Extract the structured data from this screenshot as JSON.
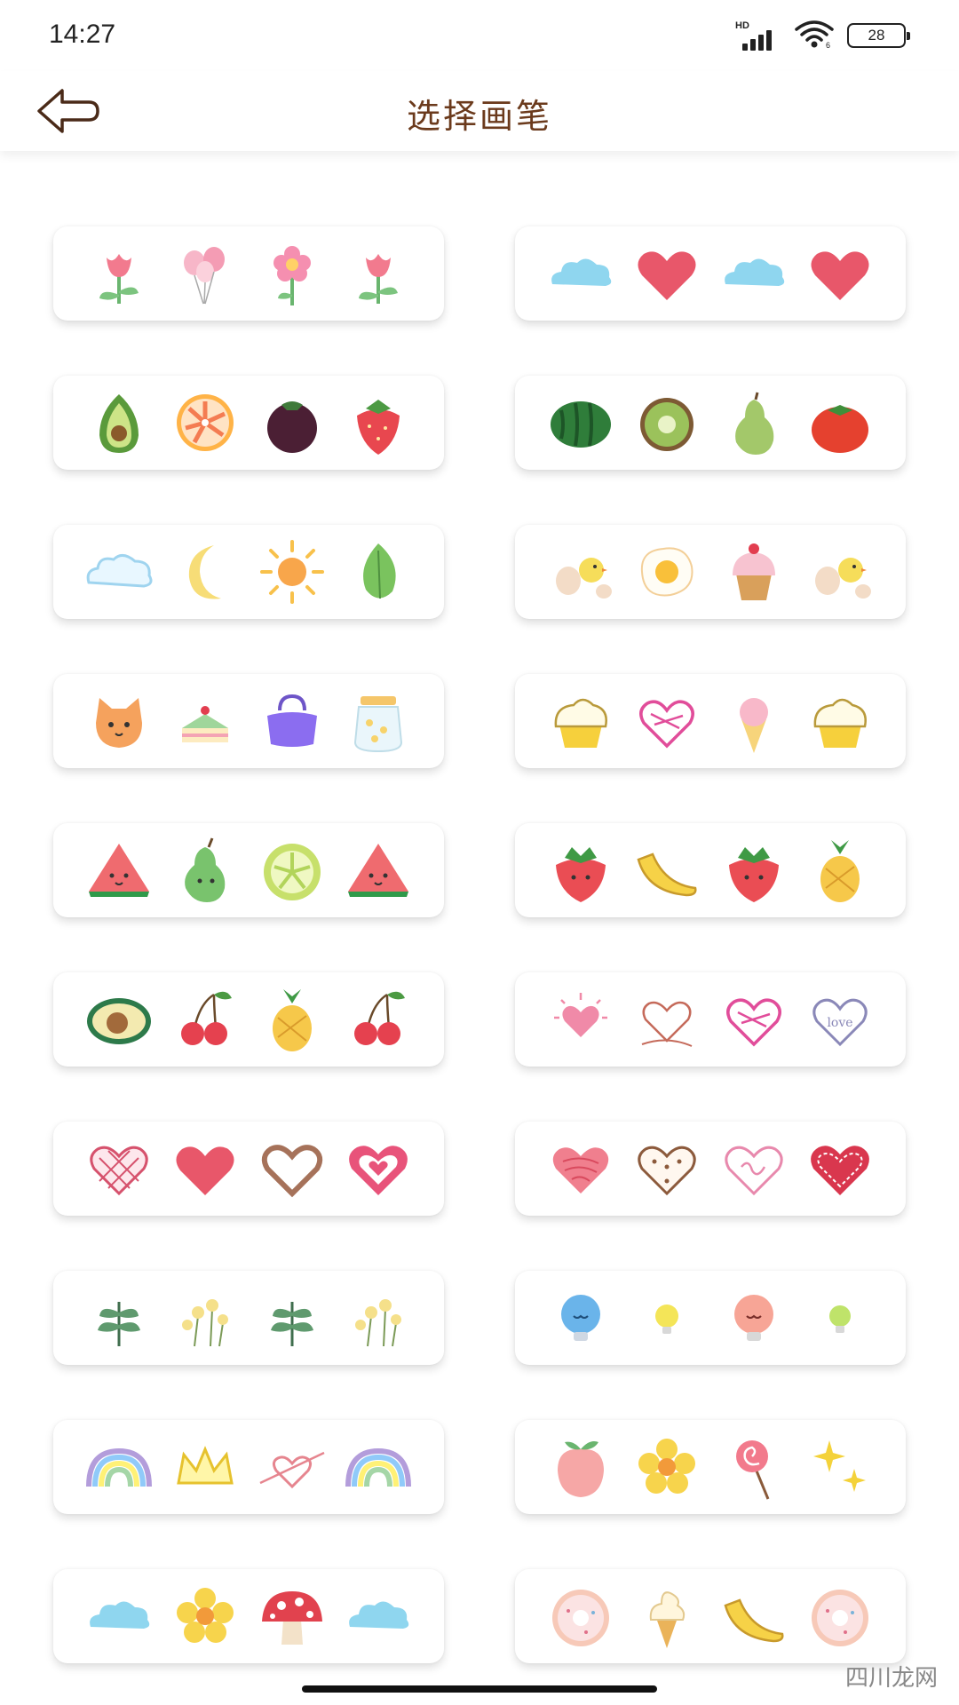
{
  "status_bar": {
    "time": "14:27",
    "network_label": "HD",
    "battery": "28"
  },
  "header": {
    "title": "选择画笔",
    "back_icon": "back-arrow-icon"
  },
  "watermark": "四川龙网",
  "brushes": [
    {
      "icons": [
        "pink-tulip-icon",
        "pink-balloons-icon",
        "pink-flower-icon",
        "pink-tulip-icon"
      ]
    },
    {
      "icons": [
        "blue-cloud-icon",
        "red-heart-icon",
        "blue-cloud-icon",
        "red-heart-icon"
      ]
    },
    {
      "icons": [
        "avocado-icon",
        "grapefruit-slice-icon",
        "mangosteen-icon",
        "strawberry-icon"
      ]
    },
    {
      "icons": [
        "watermelon-icon",
        "kiwi-icon",
        "green-pear-icon",
        "tomato-icon"
      ]
    },
    {
      "icons": [
        "cloud-icon",
        "crescent-moon-icon",
        "sun-icon",
        "green-leaf-icon"
      ]
    },
    {
      "icons": [
        "chick-egg-icon",
        "fried-egg-icon",
        "cupcake-icon",
        "chick-egg-icon"
      ]
    },
    {
      "icons": [
        "cat-face-icon",
        "cake-slice-icon",
        "purple-handbag-icon",
        "candy-jar-icon"
      ]
    },
    {
      "icons": [
        "cream-cupcake-icon",
        "scribble-heart-icon",
        "ice-cream-cone-icon",
        "cream-cupcake-icon"
      ]
    },
    {
      "icons": [
        "watermelon-slice-icon",
        "smiling-pear-icon",
        "lime-slice-icon",
        "watermelon-slice-icon"
      ]
    },
    {
      "icons": [
        "smiling-strawberry-icon",
        "banana-icon",
        "smiling-strawberry-icon",
        "pineapple-icon"
      ]
    },
    {
      "icons": [
        "smiling-avocado-icon",
        "cherries-icon",
        "pineapple-icon",
        "cherries-icon"
      ]
    },
    {
      "icons": [
        "glowing-heart-icon",
        "outline-heart-icon",
        "scribble-heart-icon",
        "love-heart-icon"
      ]
    },
    {
      "icons": [
        "lattice-heart-icon",
        "red-heart-icon",
        "brown-outline-heart-icon",
        "pink-layered-heart-icon"
      ]
    },
    {
      "icons": [
        "sketchy-heart-icon",
        "dotted-heart-icon",
        "pink-doodle-heart-icon",
        "red-stitched-heart-icon"
      ]
    },
    {
      "icons": [
        "green-leaves-icon",
        "yellow-flowers-icon",
        "green-leaves-icon",
        "yellow-flowers-icon"
      ]
    },
    {
      "icons": [
        "blue-bulb-icon",
        "yellow-bulb-icon",
        "pink-bulb-icon",
        "green-bulb-icon"
      ]
    },
    {
      "icons": [
        "rainbow-icon",
        "yellow-crown-icon",
        "heart-arrow-icon",
        "rainbow-icon"
      ]
    },
    {
      "icons": [
        "peach-icon",
        "yellow-flower-icon",
        "lollipop-icon",
        "sparkles-icon"
      ]
    },
    {
      "icons": [
        "blue-cloud-icon",
        "yellow-flower-icon",
        "red-mushroom-icon",
        "blue-cloud-icon"
      ]
    },
    {
      "icons": [
        "donut-icon",
        "soft-serve-icon",
        "banana-icon",
        "donut-icon"
      ]
    }
  ]
}
